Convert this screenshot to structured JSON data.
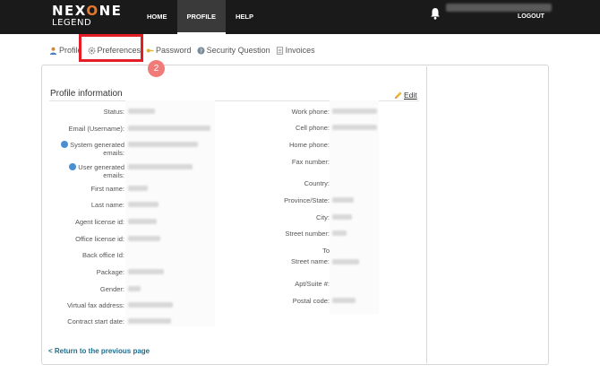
{
  "brand": {
    "name_part1": "NEX",
    "name_o": "O",
    "name_part2": "NE",
    "sub": "LEGEND",
    "accent": "#e8772e"
  },
  "nav": {
    "home": "HOME",
    "profile": "PROFILE",
    "help": "HELP",
    "logout": "LOGOUT"
  },
  "tabs": {
    "profile": "Profile",
    "preferences": "Preferences",
    "password": "Password",
    "security_question": "Security Question",
    "invoices": "Invoices"
  },
  "annotation": {
    "step": "2",
    "highlight_color": "#e41e26"
  },
  "section": {
    "title": "Profile information",
    "edit": "Edit"
  },
  "left_fields": {
    "status": "Status:",
    "email": "Email (Username):",
    "system_emails_1": "System generated",
    "system_emails_2": "emails:",
    "user_emails_1": "User generated",
    "user_emails_2": "emails:",
    "first_name": "First name:",
    "last_name": "Last name:",
    "agent_license": "Agent license id:",
    "office_license": "Office license id:",
    "back_office": "Back office Id:",
    "package": "Package:",
    "gender": "Gender:",
    "virtual_fax": "Virtual fax address:",
    "contract_start": "Contract start date:"
  },
  "right_fields": {
    "work_phone": "Work phone:",
    "cell_phone": "Cell phone:",
    "home_phone": "Home phone:",
    "fax_number": "Fax number:",
    "country": "Country:",
    "province": "Province/State:",
    "city": "City:",
    "street_number": "Street number:",
    "to": "To",
    "street_name": "Street name:",
    "apt": "Apt/Suite #:",
    "postal_code": "Postal code:"
  },
  "back_link": "< Return to the previous page"
}
